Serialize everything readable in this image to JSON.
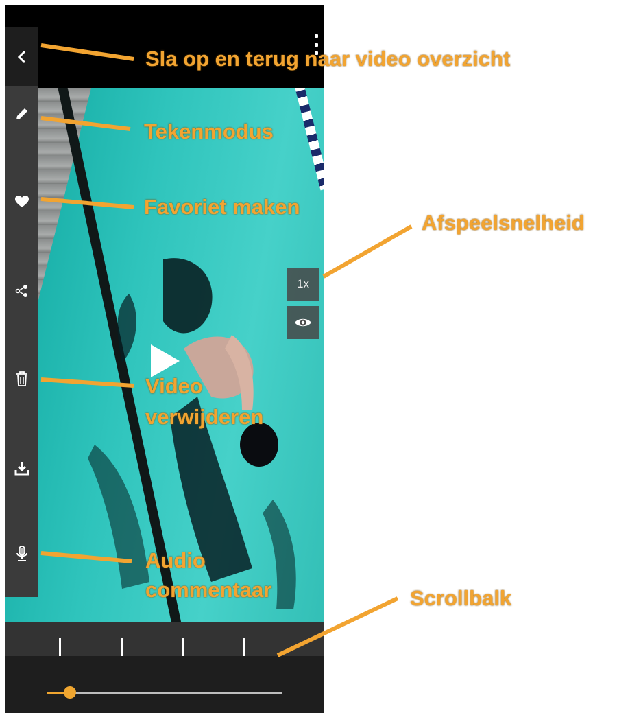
{
  "player": {
    "speed_label": "1x",
    "progress": 0.1,
    "timeline_ticks": 4
  },
  "icons": {
    "back": "chevron-left-icon",
    "menu": "more-vertical-icon",
    "draw": "pencil-icon",
    "favorite": "heart-icon",
    "share": "share-icon",
    "delete": "trash-icon",
    "download": "download-icon",
    "audio": "microphone-icon",
    "visibility": "eye-icon",
    "play": "play-icon"
  },
  "annotations": {
    "save_back": "Sla op en terug naar video overzicht",
    "draw_mode": "Tekenmodus",
    "favorite": "Favoriet maken",
    "playback_speed": "Afspeelsnelheid",
    "delete_line1": "Video",
    "delete_line2": "verwijderen",
    "audio_line1": "Audio",
    "audio_line2": "commentaar",
    "scrollbar": "Scrollbalk"
  },
  "colors": {
    "annotation": "#f2a431",
    "accent": "#f0a630",
    "sidebar": "#3b3b3b",
    "bar": "#1e1e1e",
    "pool": "#2fc4bc"
  }
}
